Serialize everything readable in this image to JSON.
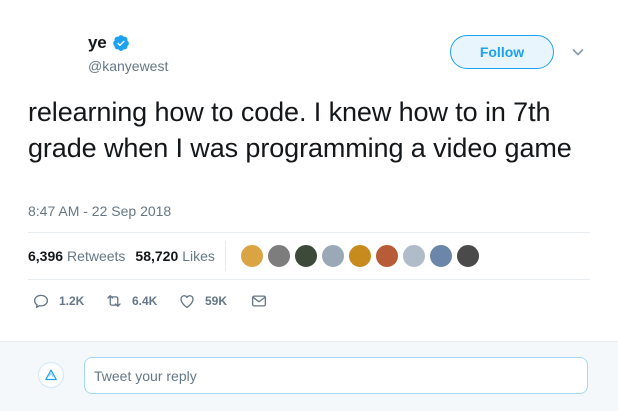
{
  "author": {
    "display_name": "ye",
    "handle": "@kanyewest",
    "verified": true,
    "avatar_icon": "user-avatar"
  },
  "header": {
    "follow_label": "Follow",
    "menu_icon": "chevron-down-icon"
  },
  "tweet": {
    "text": "relearning how to code.  I knew how to in 7th grade when I was programming a video game",
    "timestamp": "8:47 AM - 22 Sep 2018"
  },
  "stats": {
    "retweets_count": "6,396",
    "retweets_label": "Retweets",
    "likes_count": "58,720",
    "likes_label": "Likes",
    "liker_colors": [
      "#d9a441",
      "#7d7d7d",
      "#3d4a3a",
      "#9aa8b8",
      "#c68a1d",
      "#b75c36",
      "#b0bcc8",
      "#6b86a8",
      "#4a4a4a"
    ]
  },
  "actions": {
    "reply_count": "1.2K",
    "retweet_count": "6.4K",
    "like_count": "59K"
  },
  "reply": {
    "placeholder": "Tweet your reply"
  },
  "colors": {
    "brand_blue": "#1da1f2",
    "text_primary": "#14171a",
    "text_secondary": "#657786"
  }
}
